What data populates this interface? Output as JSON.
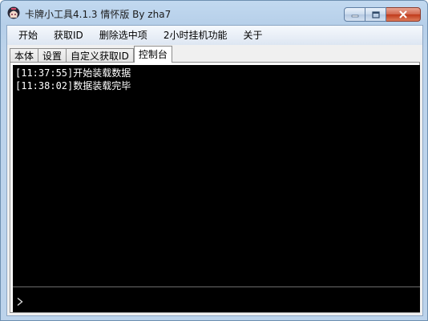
{
  "window": {
    "title": "卡牌小工具4.1.3 情怀版 By zha7",
    "icon": "anime-avatar-icon"
  },
  "menu": {
    "items": [
      {
        "label": "开始"
      },
      {
        "label": "获取ID"
      },
      {
        "label": "删除选中项"
      },
      {
        "label": "2小时挂机功能"
      },
      {
        "label": "关于"
      }
    ]
  },
  "tabs": [
    {
      "label": "本体",
      "active": false
    },
    {
      "label": "设置",
      "active": false
    },
    {
      "label": "自定义获取ID",
      "active": false
    },
    {
      "label": "控制台",
      "active": true
    }
  ],
  "console": {
    "lines": [
      {
        "text": "[11:37:55]开始装载数据"
      },
      {
        "text": "[11:38:02]数据装载完毕"
      }
    ],
    "input_value": "",
    "prompt_icon": "chevron-right-icon"
  },
  "colors": {
    "console_bg": "#000000",
    "console_text": "#ffffff",
    "close_button": "#c94a2c"
  }
}
